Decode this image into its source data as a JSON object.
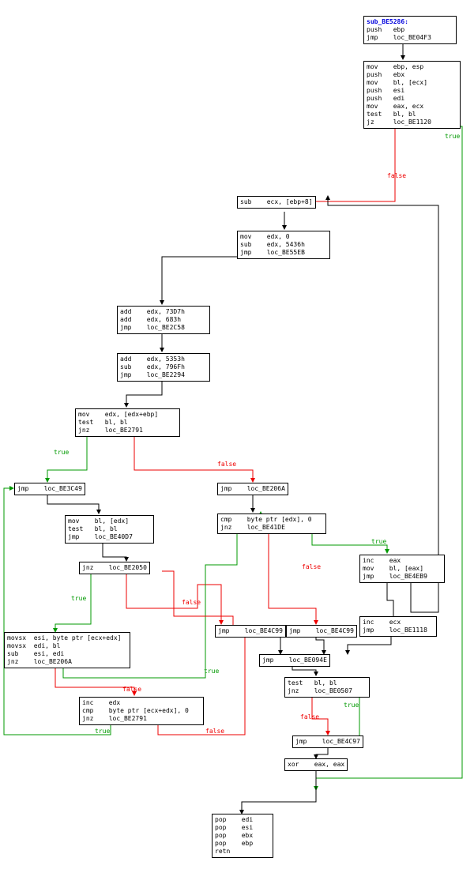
{
  "n0": {
    "sub": "sub_BE5286:",
    "l": [
      "push   ebp",
      "jmp    loc_BE04F3"
    ]
  },
  "n1": {
    "l": [
      "mov    ebp, esp",
      "push   ebx",
      "mov    bl, [ecx]",
      "push   esi",
      "push   edi",
      "mov    eax, ecx",
      "test   bl, bl",
      "jz     loc_BE1120"
    ]
  },
  "n2": {
    "l": [
      "sub    ecx, [ebp+8]"
    ]
  },
  "n3": {
    "l": [
      "mov    edx, 0",
      "sub    edx, 5436h",
      "jmp    loc_BE55EB"
    ]
  },
  "n4": {
    "l": [
      "add    edx, 73D7h",
      "add    edx, 683h",
      "jmp    loc_BE2C58"
    ]
  },
  "n5": {
    "l": [
      "add    edx, 5353h",
      "sub    edx, 796Fh",
      "jmp    loc_BE2294"
    ]
  },
  "n6": {
    "l": [
      "mov    edx, [edx+ebp]",
      "test   bl, bl",
      "jnz    loc_BE2791"
    ]
  },
  "n7": {
    "l": [
      "jmp    loc_BE3C49"
    ]
  },
  "n8": {
    "l": [
      "mov    bl, [edx]",
      "test   bl, bl",
      "jmp    loc_BE40D7"
    ]
  },
  "n9": {
    "l": [
      "jnz    loc_BE2050"
    ]
  },
  "n10": {
    "l": [
      "movsx  esi, byte ptr [ecx+edx]",
      "movsx  edi, bl",
      "sub    esi, edi",
      "jnz    loc_BE206A"
    ]
  },
  "n11": {
    "l": [
      "inc    edx",
      "cmp    byte ptr [ecx+edx], 0",
      "jnz    loc_BE2791"
    ]
  },
  "n12": {
    "l": [
      "jmp    loc_BE206A"
    ]
  },
  "n13": {
    "l": [
      "cmp    byte ptr [edx], 0",
      "jnz    loc_BE41DE"
    ]
  },
  "n14": {
    "l": [
      "jmp    loc_BE4C99"
    ]
  },
  "n15": {
    "l": [
      "jmp    loc_BE4C99"
    ]
  },
  "n16": {
    "l": [
      "jmp    loc_BE094E"
    ]
  },
  "n17": {
    "l": [
      "test   bl, bl",
      "jnz    loc_BE0507"
    ]
  },
  "n18": {
    "l": [
      "jmp    loc_BE4C97"
    ]
  },
  "n19": {
    "l": [
      "xor    eax, eax"
    ]
  },
  "n20": {
    "l": [
      "pop    edi",
      "pop    esi",
      "pop    ebx",
      "pop    ebp",
      "retn"
    ]
  },
  "n21": {
    "l": [
      "inc    eax",
      "mov    bl, [eax]",
      "jmp    loc_BE4EB9"
    ]
  },
  "n22": {
    "l": [
      "inc    ecx",
      "jmp    loc_BE1118"
    ]
  }
}
